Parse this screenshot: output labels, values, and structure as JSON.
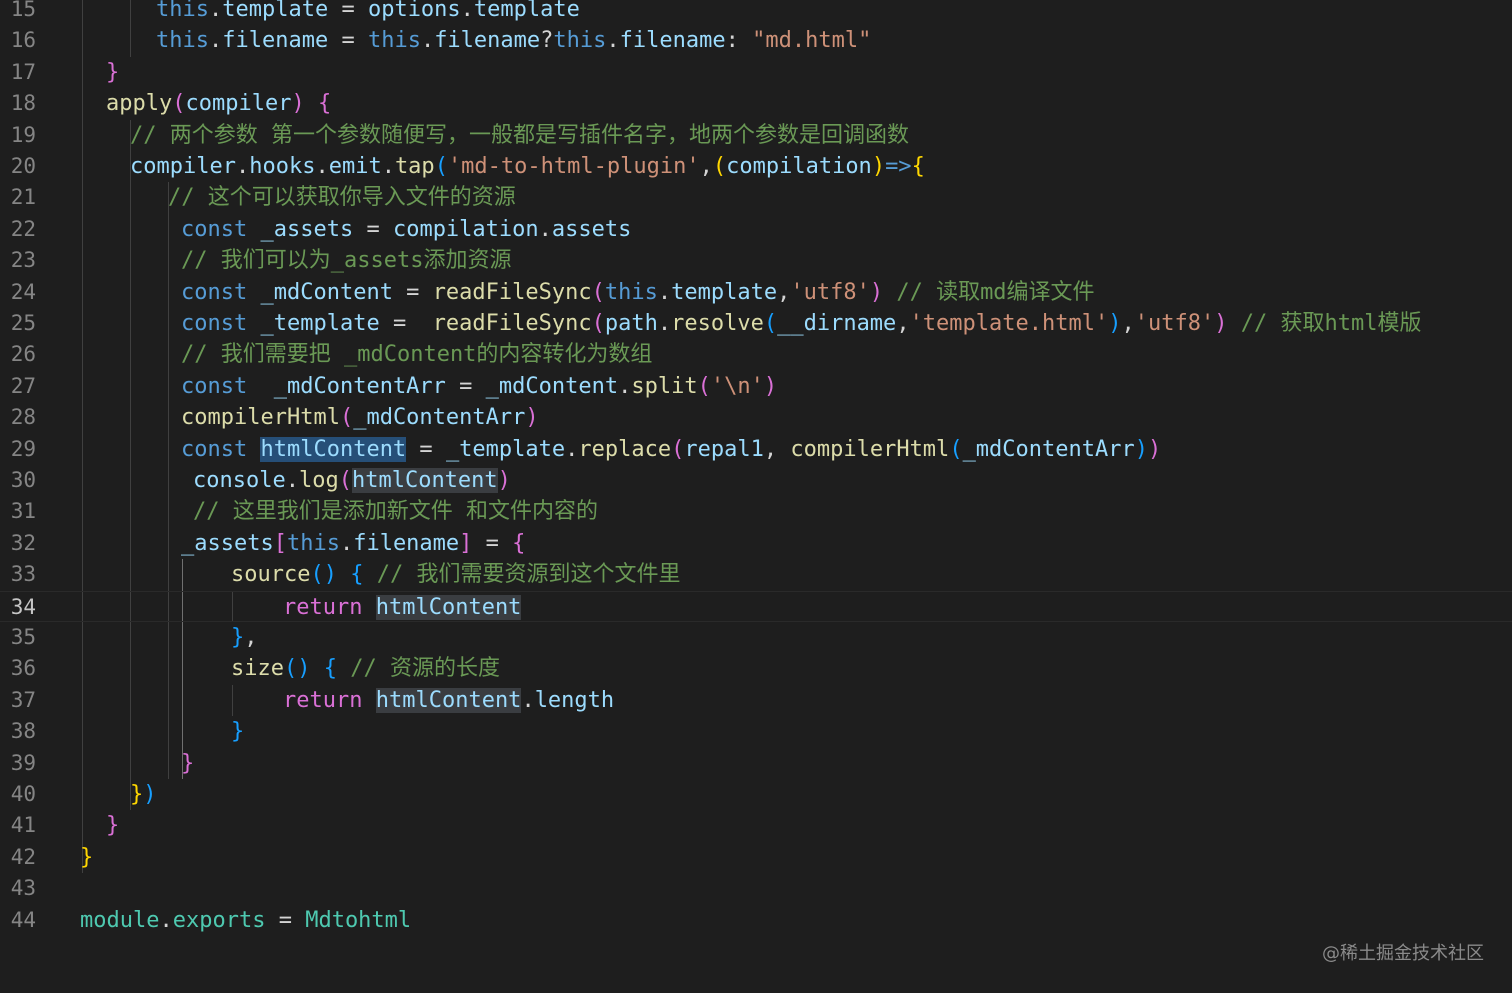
{
  "editor": {
    "current_line": "34",
    "lines": [
      {
        "n": "15",
        "tokens": [
          [
            "this",
            "kw"
          ],
          [
            ".",
            "pl"
          ],
          [
            "template",
            "id"
          ],
          [
            " = ",
            "pl"
          ],
          [
            "options",
            "id"
          ],
          [
            ".",
            "pl"
          ],
          [
            "template",
            "id"
          ]
        ]
      },
      {
        "n": "16",
        "tokens": [
          [
            "this",
            "kw"
          ],
          [
            ".",
            "pl"
          ],
          [
            "filename",
            "id"
          ],
          [
            " = ",
            "pl"
          ],
          [
            "this",
            "kw"
          ],
          [
            ".",
            "pl"
          ],
          [
            "filename",
            "id"
          ],
          [
            "?",
            "pl"
          ],
          [
            "this",
            "kw"
          ],
          [
            ".",
            "pl"
          ],
          [
            "filename",
            "id"
          ],
          [
            ": ",
            "pl"
          ],
          [
            "\"md.html\"",
            "str"
          ]
        ]
      },
      {
        "n": "17",
        "tokens": [
          [
            "}",
            "p2"
          ]
        ]
      },
      {
        "n": "18",
        "tokens": [
          [
            "apply",
            "fn"
          ],
          [
            "(",
            "p2"
          ],
          [
            "compiler",
            "id"
          ],
          [
            ")",
            "p2"
          ],
          [
            " ",
            "pl"
          ],
          [
            "{",
            "p2"
          ]
        ]
      },
      {
        "n": "19",
        "tokens": [
          [
            "// 两个参数 第一个参数随便写，一般都是写插件名字，地两个参数是回调函数",
            "cm"
          ]
        ]
      },
      {
        "n": "20",
        "tokens": [
          [
            "compiler",
            "id"
          ],
          [
            ".",
            "pl"
          ],
          [
            "hooks",
            "id"
          ],
          [
            ".",
            "pl"
          ],
          [
            "emit",
            "id"
          ],
          [
            ".",
            "pl"
          ],
          [
            "tap",
            "fn"
          ],
          [
            "(",
            "p3"
          ],
          [
            "'md-to-html-plugin'",
            "str"
          ],
          [
            ",",
            "pl"
          ],
          [
            "(",
            "p1"
          ],
          [
            "compilation",
            "id"
          ],
          [
            ")",
            "p1"
          ],
          [
            "=>",
            "kw"
          ],
          [
            "{",
            "p1"
          ]
        ]
      },
      {
        "n": "21",
        "tokens": [
          [
            "// 这个可以获取你导入文件的资源",
            "cm"
          ]
        ]
      },
      {
        "n": "22",
        "tokens": [
          [
            "const",
            "kw"
          ],
          [
            " ",
            "pl"
          ],
          [
            "_assets",
            "id"
          ],
          [
            " = ",
            "pl"
          ],
          [
            "compilation",
            "id"
          ],
          [
            ".",
            "pl"
          ],
          [
            "assets",
            "id"
          ]
        ]
      },
      {
        "n": "23",
        "tokens": [
          [
            "// 我们可以为_assets添加资源",
            "cm"
          ]
        ]
      },
      {
        "n": "24",
        "tokens": [
          [
            "const",
            "kw"
          ],
          [
            " ",
            "pl"
          ],
          [
            "_mdContent",
            "id"
          ],
          [
            " = ",
            "pl"
          ],
          [
            "readFileSync",
            "fn"
          ],
          [
            "(",
            "p2"
          ],
          [
            "this",
            "kw"
          ],
          [
            ".",
            "pl"
          ],
          [
            "template",
            "id"
          ],
          [
            ",",
            "pl"
          ],
          [
            "'utf8'",
            "str"
          ],
          [
            ")",
            "p2"
          ],
          [
            " ",
            "pl"
          ],
          [
            "// 读取md编译文件",
            "cm"
          ]
        ]
      },
      {
        "n": "25",
        "tokens": [
          [
            "const",
            "kw"
          ],
          [
            " ",
            "pl"
          ],
          [
            "_template",
            "id"
          ],
          [
            " =  ",
            "pl"
          ],
          [
            "readFileSync",
            "fn"
          ],
          [
            "(",
            "p2"
          ],
          [
            "path",
            "id"
          ],
          [
            ".",
            "pl"
          ],
          [
            "resolve",
            "fn"
          ],
          [
            "(",
            "p3"
          ],
          [
            "__dirname",
            "id"
          ],
          [
            ",",
            "pl"
          ],
          [
            "'template.html'",
            "str"
          ],
          [
            ")",
            "p3"
          ],
          [
            ",",
            "pl"
          ],
          [
            "'utf8'",
            "str"
          ],
          [
            ")",
            "p2"
          ],
          [
            " ",
            "pl"
          ],
          [
            "// 获取html模版",
            "cm"
          ]
        ]
      },
      {
        "n": "26",
        "tokens": [
          [
            "// 我们需要把 _mdContent的内容转化为数组",
            "cm"
          ]
        ]
      },
      {
        "n": "27",
        "tokens": [
          [
            "const",
            "kw"
          ],
          [
            "  ",
            "pl"
          ],
          [
            "_mdContentArr",
            "id"
          ],
          [
            " = ",
            "pl"
          ],
          [
            "_mdContent",
            "id"
          ],
          [
            ".",
            "pl"
          ],
          [
            "split",
            "fn"
          ],
          [
            "(",
            "p2"
          ],
          [
            "'\\n'",
            "str"
          ],
          [
            ")",
            "p2"
          ]
        ]
      },
      {
        "n": "28",
        "tokens": [
          [
            "compilerHtml",
            "fn"
          ],
          [
            "(",
            "p2"
          ],
          [
            "_mdContentArr",
            "id"
          ],
          [
            ")",
            "p2"
          ]
        ]
      },
      {
        "n": "29",
        "tokens": [
          [
            "const",
            "kw"
          ],
          [
            " ",
            "pl"
          ],
          [
            "htmlContent",
            "id hl"
          ],
          [
            " = ",
            "pl"
          ],
          [
            "_template",
            "id"
          ],
          [
            ".",
            "pl"
          ],
          [
            "replace",
            "fn"
          ],
          [
            "(",
            "p2"
          ],
          [
            "repal1",
            "id"
          ],
          [
            ", ",
            "pl"
          ],
          [
            "compilerHtml",
            "fn"
          ],
          [
            "(",
            "p3"
          ],
          [
            "_mdContentArr",
            "id"
          ],
          [
            ")",
            "p3"
          ],
          [
            ")",
            "p2"
          ]
        ]
      },
      {
        "n": "30",
        "tokens": [
          [
            "console",
            "id"
          ],
          [
            ".",
            "pl"
          ],
          [
            "log",
            "fn"
          ],
          [
            "(",
            "p2"
          ],
          [
            "htmlContent",
            "id hl2"
          ],
          [
            ")",
            "p2"
          ]
        ]
      },
      {
        "n": "31",
        "tokens": [
          [
            "// 这里我们是添加新文件 和文件内容的",
            "cm"
          ]
        ]
      },
      {
        "n": "32",
        "tokens": [
          [
            "_assets",
            "id"
          ],
          [
            "[",
            "p2"
          ],
          [
            "this",
            "kw"
          ],
          [
            ".",
            "pl"
          ],
          [
            "filename",
            "id"
          ],
          [
            "]",
            "p2"
          ],
          [
            " = ",
            "pl"
          ],
          [
            "{",
            "p2"
          ]
        ]
      },
      {
        "n": "33",
        "tokens": [
          [
            "source",
            "fn"
          ],
          [
            "()",
            "p3"
          ],
          [
            " ",
            "pl"
          ],
          [
            "{",
            "p3"
          ],
          [
            " ",
            "pl"
          ],
          [
            "// 我们需要资源到这个文件里",
            "cm"
          ]
        ]
      },
      {
        "n": "34",
        "tokens": [
          [
            "return",
            "p2"
          ],
          [
            " ",
            "pl"
          ],
          [
            "htmlContent",
            "id hl2"
          ]
        ]
      },
      {
        "n": "35",
        "tokens": [
          [
            "}",
            "p3"
          ],
          [
            ",",
            "pl"
          ]
        ]
      },
      {
        "n": "36",
        "tokens": [
          [
            "size",
            "fn"
          ],
          [
            "()",
            "p3"
          ],
          [
            " ",
            "pl"
          ],
          [
            "{",
            "p3"
          ],
          [
            " ",
            "pl"
          ],
          [
            "// 资源的长度",
            "cm"
          ]
        ]
      },
      {
        "n": "37",
        "tokens": [
          [
            "return",
            "p2"
          ],
          [
            " ",
            "pl"
          ],
          [
            "htmlContent",
            "id hl2"
          ],
          [
            ".",
            "pl"
          ],
          [
            "length",
            "id"
          ]
        ]
      },
      {
        "n": "38",
        "tokens": [
          [
            "}",
            "p3"
          ]
        ]
      },
      {
        "n": "39",
        "tokens": [
          [
            "}",
            "p2"
          ]
        ]
      },
      {
        "n": "40",
        "tokens": [
          [
            "}",
            "p1"
          ],
          [
            ")",
            "p3"
          ]
        ]
      },
      {
        "n": "41",
        "tokens": [
          [
            "}",
            "p2"
          ]
        ]
      },
      {
        "n": "42",
        "tokens": [
          [
            "}",
            "p1"
          ]
        ]
      },
      {
        "n": "43",
        "tokens": []
      },
      {
        "n": "44",
        "tokens": [
          [
            "module",
            "ty"
          ],
          [
            ".",
            "pl"
          ],
          [
            "exports",
            "ty"
          ],
          [
            " = ",
            "pl"
          ],
          [
            "Mdtohtml",
            "ty"
          ]
        ]
      }
    ]
  },
  "watermark": "@稀土掘金技术社区"
}
